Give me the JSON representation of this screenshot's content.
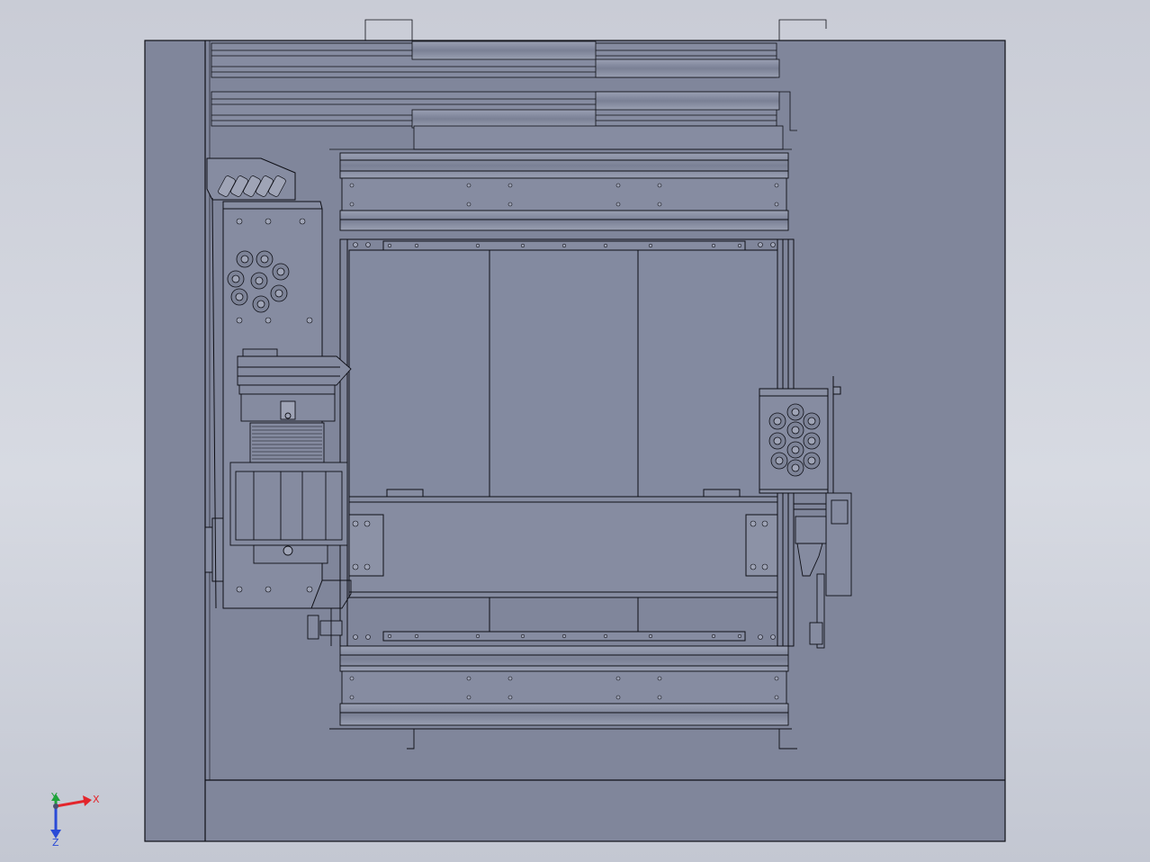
{
  "viewport": {
    "background_top": "#c9ccd6",
    "background_bottom": "#c3c7d2"
  },
  "model": {
    "body_fill": "#80869b",
    "panel_fill": "#868ca1",
    "line_color": "#0e0f16",
    "hole_fill": "#9fa4b6"
  },
  "triad": {
    "x_label": "X",
    "y_label": "Y",
    "z_label": "Z",
    "x_color": "#e3252b",
    "y_color": "#1fa33a",
    "z_color": "#2a4bd7"
  }
}
